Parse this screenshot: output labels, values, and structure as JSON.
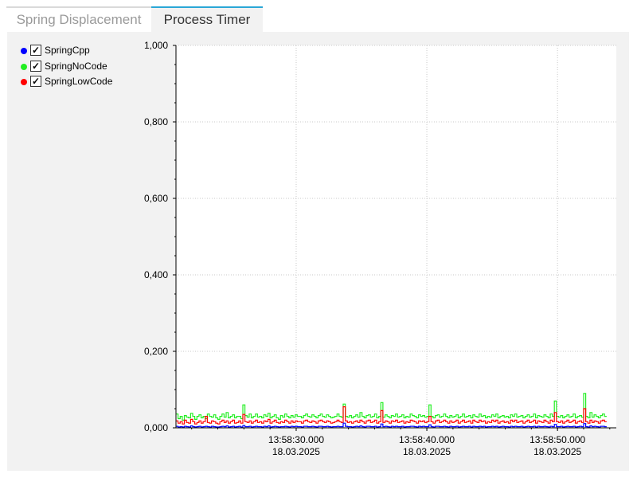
{
  "tabs": [
    {
      "label": "Spring Displacement",
      "active": false
    },
    {
      "label": "Process Timer",
      "active": true
    }
  ],
  "legend": [
    {
      "label": "SpringCpp",
      "color": "#0000ff",
      "checked": true
    },
    {
      "label": "SpringNoCode",
      "color": "#22ee22",
      "checked": true
    },
    {
      "label": "SpringLowCode",
      "color": "#ff0000",
      "checked": true
    }
  ],
  "check_glyph": "✓",
  "chart_data": {
    "type": "line",
    "title": "",
    "xlabel": "",
    "ylabel": "",
    "ylim": [
      0,
      1.0
    ],
    "yticks": [
      "1,000",
      "0,800",
      "0,600",
      "0,400",
      "0,200",
      "0,000"
    ],
    "ytick_values": [
      1.0,
      0.8,
      0.6,
      0.4,
      0.2,
      0.0
    ],
    "xlim": [
      "13:58:20.800",
      "13:58:54.500"
    ],
    "xticks": [
      {
        "time": "13:58:30.000",
        "date": "18.03.2025"
      },
      {
        "time": "13:58:40.000",
        "date": "18.03.2025"
      },
      {
        "time": "13:58:50.000",
        "date": "18.03.2025"
      }
    ],
    "grid": true,
    "series": [
      {
        "name": "SpringNoCode",
        "color": "#22ee22",
        "x_start": "13:58:20.800",
        "x_step_seconds": 0.16,
        "values": [
          0.036,
          0.024,
          0.03,
          0.02,
          0.032,
          0.028,
          0.026,
          0.038,
          0.03,
          0.022,
          0.03,
          0.034,
          0.026,
          0.03,
          0.024,
          0.036,
          0.03,
          0.028,
          0.034,
          0.026,
          0.022,
          0.03,
          0.036,
          0.028,
          0.04,
          0.026,
          0.03,
          0.034,
          0.026,
          0.03,
          0.03,
          0.024,
          0.06,
          0.032,
          0.028,
          0.036,
          0.026,
          0.03,
          0.036,
          0.028,
          0.03,
          0.026,
          0.034,
          0.03,
          0.038,
          0.026,
          0.03,
          0.034,
          0.026,
          0.022,
          0.032,
          0.028,
          0.036,
          0.03,
          0.026,
          0.032,
          0.028,
          0.034,
          0.03,
          0.03,
          0.026,
          0.032,
          0.036,
          0.03,
          0.028,
          0.034,
          0.03,
          0.026,
          0.032,
          0.036,
          0.03,
          0.028,
          0.034,
          0.03,
          0.026,
          0.028,
          0.03,
          0.036,
          0.03,
          0.028,
          0.062,
          0.03,
          0.028,
          0.032,
          0.026,
          0.03,
          0.034,
          0.028,
          0.04,
          0.03,
          0.026,
          0.032,
          0.034,
          0.028,
          0.03,
          0.036,
          0.026,
          0.03,
          0.066,
          0.028,
          0.034,
          0.03,
          0.026,
          0.032,
          0.03,
          0.036,
          0.028,
          0.03,
          0.034,
          0.026,
          0.03,
          0.028,
          0.036,
          0.032,
          0.03,
          0.026,
          0.034,
          0.03,
          0.032,
          0.028,
          0.03,
          0.06,
          0.03,
          0.026,
          0.032,
          0.034,
          0.028,
          0.03,
          0.036,
          0.03,
          0.026,
          0.032,
          0.028,
          0.03,
          0.034,
          0.026,
          0.03,
          0.036,
          0.028,
          0.03,
          0.032,
          0.026,
          0.034,
          0.03,
          0.028,
          0.036,
          0.03,
          0.032,
          0.026,
          0.03,
          0.028,
          0.034,
          0.03,
          0.036,
          0.026,
          0.03,
          0.032,
          0.028,
          0.03,
          0.026,
          0.034,
          0.03,
          0.036,
          0.028,
          0.03,
          0.032,
          0.026,
          0.03,
          0.034,
          0.028,
          0.03,
          0.036,
          0.026,
          0.032,
          0.03,
          0.028,
          0.034,
          0.03,
          0.026,
          0.036,
          0.03,
          0.07,
          0.03,
          0.028,
          0.032,
          0.026,
          0.03,
          0.034,
          0.028,
          0.03,
          0.036,
          0.026,
          0.03,
          0.032,
          0.028,
          0.09,
          0.03,
          0.026,
          0.04,
          0.028,
          0.034,
          0.03,
          0.026,
          0.032,
          0.036,
          0.03
        ]
      },
      {
        "name": "SpringLowCode",
        "color": "#ff0000",
        "x_start": "13:58:20.800",
        "x_step_seconds": 0.16,
        "values": [
          0.018,
          0.012,
          0.016,
          0.01,
          0.02,
          0.014,
          0.012,
          0.022,
          0.016,
          0.01,
          0.014,
          0.018,
          0.012,
          0.016,
          0.03,
          0.014,
          0.012,
          0.018,
          0.016,
          0.012,
          0.01,
          0.016,
          0.02,
          0.014,
          0.018,
          0.012,
          0.016,
          0.02,
          0.012,
          0.014,
          0.018,
          0.012,
          0.035,
          0.016,
          0.014,
          0.018,
          0.012,
          0.016,
          0.02,
          0.014,
          0.016,
          0.012,
          0.018,
          0.016,
          0.022,
          0.012,
          0.016,
          0.02,
          0.014,
          0.012,
          0.016,
          0.014,
          0.02,
          0.016,
          0.012,
          0.018,
          0.014,
          0.018,
          0.016,
          0.016,
          0.012,
          0.018,
          0.02,
          0.016,
          0.014,
          0.018,
          0.016,
          0.012,
          0.018,
          0.02,
          0.016,
          0.014,
          0.018,
          0.016,
          0.012,
          0.014,
          0.016,
          0.02,
          0.016,
          0.014,
          0.055,
          0.018,
          0.014,
          0.016,
          0.012,
          0.016,
          0.018,
          0.014,
          0.02,
          0.016,
          0.012,
          0.018,
          0.02,
          0.014,
          0.016,
          0.02,
          0.012,
          0.016,
          0.045,
          0.014,
          0.018,
          0.016,
          0.012,
          0.018,
          0.016,
          0.02,
          0.014,
          0.016,
          0.018,
          0.012,
          0.016,
          0.014,
          0.02,
          0.018,
          0.016,
          0.012,
          0.018,
          0.016,
          0.018,
          0.014,
          0.016,
          0.03,
          0.016,
          0.012,
          0.018,
          0.02,
          0.014,
          0.016,
          0.02,
          0.016,
          0.012,
          0.018,
          0.014,
          0.016,
          0.02,
          0.012,
          0.016,
          0.02,
          0.014,
          0.016,
          0.018,
          0.012,
          0.02,
          0.016,
          0.014,
          0.02,
          0.016,
          0.018,
          0.012,
          0.016,
          0.014,
          0.02,
          0.016,
          0.02,
          0.012,
          0.016,
          0.018,
          0.014,
          0.016,
          0.012,
          0.02,
          0.016,
          0.02,
          0.014,
          0.016,
          0.018,
          0.012,
          0.016,
          0.02,
          0.014,
          0.016,
          0.02,
          0.012,
          0.018,
          0.016,
          0.014,
          0.02,
          0.016,
          0.012,
          0.02,
          0.016,
          0.04,
          0.016,
          0.014,
          0.018,
          0.012,
          0.016,
          0.02,
          0.014,
          0.016,
          0.02,
          0.012,
          0.016,
          0.018,
          0.014,
          0.05,
          0.016,
          0.012,
          0.02,
          0.014,
          0.018,
          0.016,
          0.012,
          0.018,
          0.02,
          0.016
        ]
      },
      {
        "name": "SpringCpp",
        "color": "#0000ff",
        "x_start": "13:58:20.800",
        "x_step_seconds": 0.16,
        "values": [
          0.004,
          0.002,
          0.003,
          0.002,
          0.004,
          0.003,
          0.002,
          0.005,
          0.003,
          0.002,
          0.003,
          0.004,
          0.002,
          0.003,
          0.004,
          0.003,
          0.002,
          0.004,
          0.003,
          0.002,
          0.002,
          0.003,
          0.004,
          0.003,
          0.005,
          0.002,
          0.003,
          0.004,
          0.002,
          0.003,
          0.004,
          0.002,
          0.006,
          0.003,
          0.003,
          0.004,
          0.002,
          0.003,
          0.004,
          0.003,
          0.003,
          0.002,
          0.004,
          0.003,
          0.005,
          0.002,
          0.003,
          0.004,
          0.003,
          0.002,
          0.003,
          0.003,
          0.004,
          0.003,
          0.002,
          0.004,
          0.003,
          0.004,
          0.003,
          0.003,
          0.002,
          0.004,
          0.004,
          0.003,
          0.003,
          0.004,
          0.003,
          0.002,
          0.004,
          0.004,
          0.003,
          0.003,
          0.004,
          0.003,
          0.002,
          0.003,
          0.003,
          0.004,
          0.003,
          0.003,
          0.012,
          0.004,
          0.003,
          0.003,
          0.002,
          0.003,
          0.004,
          0.003,
          0.005,
          0.003,
          0.002,
          0.004,
          0.004,
          0.003,
          0.003,
          0.004,
          0.002,
          0.003,
          0.01,
          0.003,
          0.004,
          0.003,
          0.002,
          0.004,
          0.003,
          0.004,
          0.003,
          0.003,
          0.004,
          0.002,
          0.003,
          0.003,
          0.004,
          0.004,
          0.003,
          0.002,
          0.004,
          0.003,
          0.004,
          0.003,
          0.003,
          0.008,
          0.003,
          0.002,
          0.004,
          0.004,
          0.003,
          0.003,
          0.004,
          0.003,
          0.002,
          0.004,
          0.003,
          0.003,
          0.004,
          0.002,
          0.003,
          0.004,
          0.003,
          0.003,
          0.004,
          0.002,
          0.004,
          0.003,
          0.003,
          0.004,
          0.003,
          0.004,
          0.002,
          0.003,
          0.003,
          0.004,
          0.003,
          0.004,
          0.002,
          0.003,
          0.004,
          0.003,
          0.003,
          0.002,
          0.004,
          0.003,
          0.004,
          0.003,
          0.003,
          0.004,
          0.002,
          0.003,
          0.004,
          0.003,
          0.003,
          0.004,
          0.002,
          0.004,
          0.003,
          0.003,
          0.004,
          0.003,
          0.002,
          0.004,
          0.003,
          0.009,
          0.003,
          0.003,
          0.004,
          0.002,
          0.003,
          0.004,
          0.003,
          0.003,
          0.004,
          0.002,
          0.003,
          0.004,
          0.003,
          0.011,
          0.003,
          0.002,
          0.005,
          0.003,
          0.004,
          0.003,
          0.002,
          0.004,
          0.004,
          0.003
        ]
      }
    ]
  }
}
